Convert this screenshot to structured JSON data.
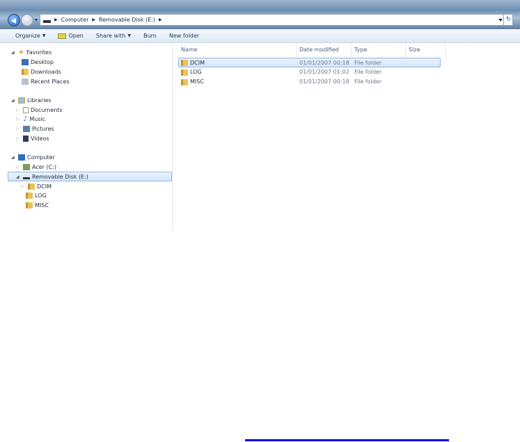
{
  "address": {
    "crumbs": [
      "Computer",
      "Removable Disk (E:)"
    ]
  },
  "toolbar": [
    "Organize",
    "Open",
    "Share with",
    "Burn",
    "New folder"
  ],
  "nav": {
    "favorites": {
      "label": "Favorites",
      "items": [
        "Desktop",
        "Downloads",
        "Recent Places"
      ]
    },
    "libraries": {
      "label": "Libraries",
      "items": [
        "Documents",
        "Music",
        "Pictures",
        "Videos"
      ]
    },
    "computer": {
      "label": "Computer",
      "items": [
        "Acer (C:)",
        "Removable Disk (E:)"
      ],
      "subfolders": [
        "DCIM",
        "LOG",
        "MISC"
      ]
    }
  },
  "columns": [
    "Name",
    "Date modified",
    "Type",
    "Size"
  ],
  "files": [
    {
      "name": "DCIM",
      "date": "01/01/2007 00:18",
      "type": "File folder"
    },
    {
      "name": "LOG",
      "date": "01/01/2007 01:02",
      "type": "File folder"
    },
    {
      "name": "MISC",
      "date": "01/01/2007 00:18",
      "type": "File folder"
    }
  ]
}
